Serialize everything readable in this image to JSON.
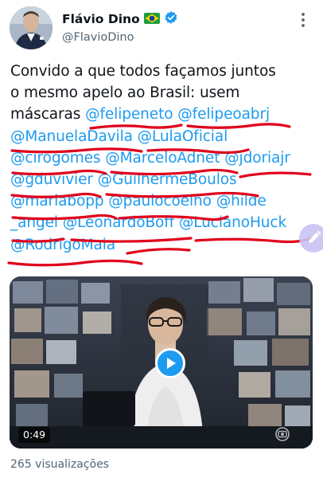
{
  "author": {
    "display_name": "Flávio Dino",
    "handle": "@FlavioDino",
    "flag_icon": "brazil-flag-icon",
    "verified_icon": "verified-badge-icon"
  },
  "menu": {
    "icon": "more-options-icon"
  },
  "tweet": {
    "lines": [
      [
        {
          "text": "Convido a que todos façamos juntos"
        }
      ],
      [
        {
          "text": "o mesmo apelo ao Brasil: usem"
        }
      ],
      [
        {
          "text": "máscaras "
        },
        {
          "text": "@felipeneto",
          "mention": true
        },
        {
          "text": " "
        },
        {
          "text": "@felipeoabrj",
          "mention": true
        }
      ],
      [
        {
          "text": "@ManuelaDavila",
          "mention": true
        },
        {
          "text": " "
        },
        {
          "text": "@LulaOficial",
          "mention": true
        }
      ],
      [
        {
          "text": "@cirogomes",
          "mention": true
        },
        {
          "text": " "
        },
        {
          "text": "@MarceloAdnet",
          "mention": true
        },
        {
          "text": " "
        },
        {
          "text": "@jdoriajr",
          "mention": true
        }
      ],
      [
        {
          "text": "@gduvivier",
          "mention": true
        },
        {
          "text": " "
        },
        {
          "text": "@GuilhermeBoulos",
          "mention": true
        }
      ],
      [
        {
          "text": "@mariabopp",
          "mention": true
        },
        {
          "text": " "
        },
        {
          "text": "@paulocoelho",
          "mention": true
        },
        {
          "text": " "
        },
        {
          "text": "@hilde",
          "mention": true
        }
      ],
      [
        {
          "text": "_angel",
          "mention": true
        },
        {
          "text": " "
        },
        {
          "text": "@LeonardoBoff",
          "mention": true
        },
        {
          "text": " "
        },
        {
          "text": "@LucianoHuck",
          "mention": true
        }
      ],
      [
        {
          "text": "@RodrigoMaia",
          "mention": true
        }
      ]
    ]
  },
  "video": {
    "duration": "0:49",
    "play_icon": "play-icon",
    "watermark_icon": "globo-logo-icon"
  },
  "stats": {
    "views": "265 visualizações"
  },
  "fab": {
    "icon": "edit-pencil-icon"
  },
  "colors": {
    "mention": "#1d9bf0",
    "text": "#0f1419",
    "secondary": "#536471",
    "scribble": "#e0001b",
    "verified": "#1d9bf0"
  }
}
